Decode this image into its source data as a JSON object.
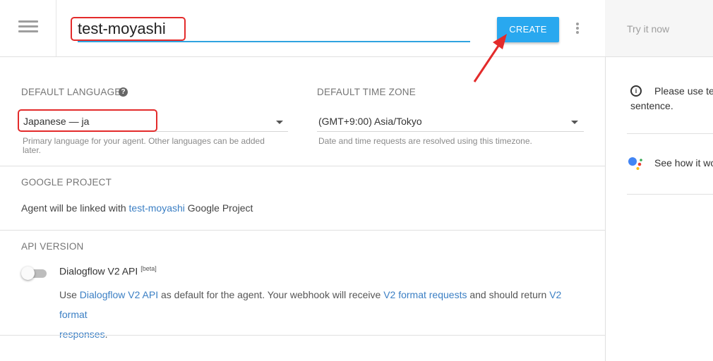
{
  "header": {
    "agent_name": "test-moyashi",
    "create_label": "CREATE",
    "try_it_now": "Try it now"
  },
  "language": {
    "label": "DEFAULT LANGUAGE",
    "value": "Japanese — ja",
    "hint": "Primary language for your agent. Other languages can be added later."
  },
  "timezone": {
    "label": "DEFAULT TIME ZONE",
    "value": "(GMT+9:00) Asia/Tokyo",
    "hint": "Date and time requests are resolved using this timezone."
  },
  "google_project": {
    "label": "GOOGLE PROJECT",
    "text_before": "Agent will be linked with ",
    "project_link": "test-moyashi",
    "text_after": " Google Project"
  },
  "api_version": {
    "label": "API VERSION",
    "toggle_label": "Dialogflow V2 API",
    "beta": "[beta]",
    "desc_1": "Use ",
    "link_1": "Dialogflow V2 API",
    "desc_2": " as default for the agent. Your webhook will receive ",
    "link_2": "V2 format requests",
    "desc_3": " and should return ",
    "link_3": "V2 format",
    "link_4": "responses",
    "desc_4": "."
  },
  "right_panel": {
    "info_text_1": "Please use te",
    "info_text_2": "sentence.",
    "assistant_text": "See how it wo"
  },
  "colors": {
    "accent": "#29a8ef",
    "link": "#3b7fc4",
    "annotation": "#e32b2b"
  }
}
